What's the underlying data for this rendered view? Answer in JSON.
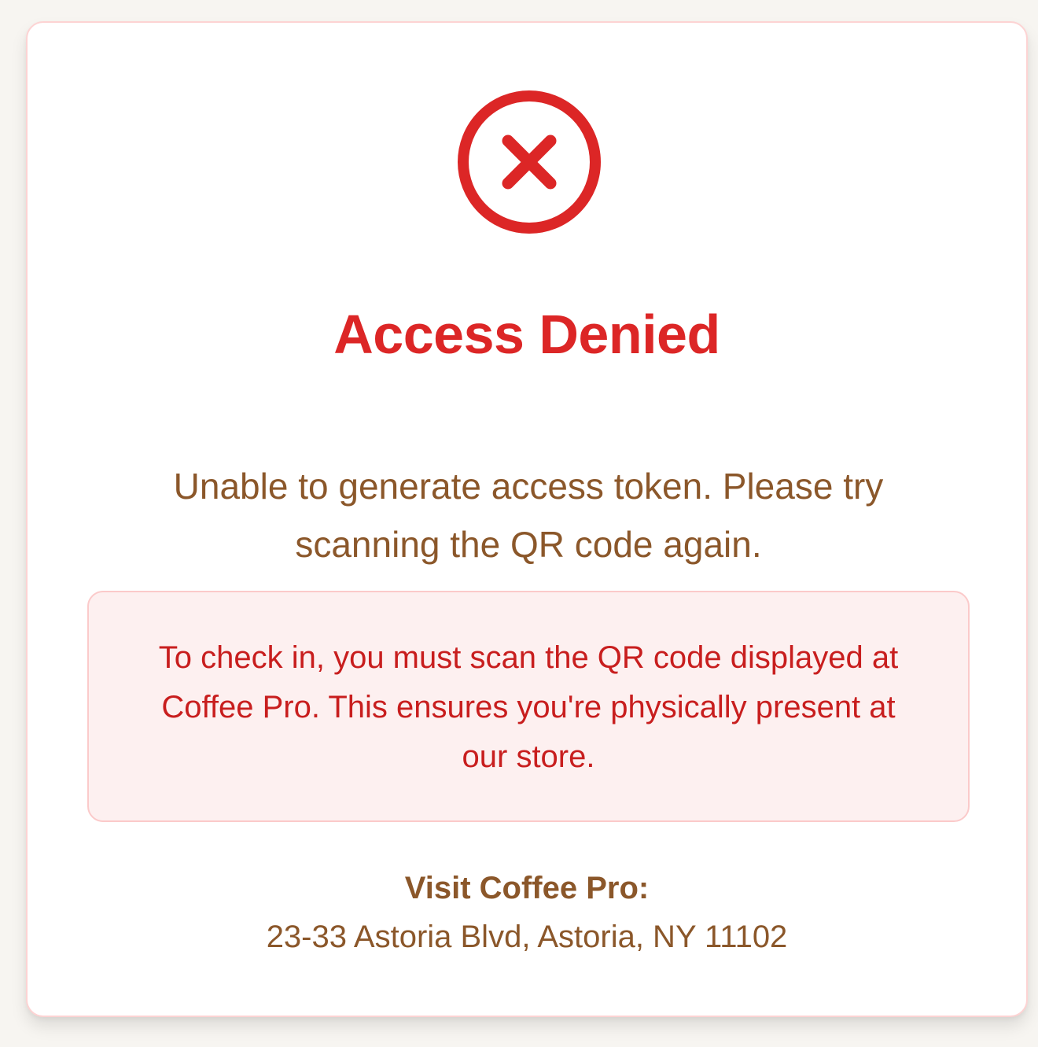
{
  "status": {
    "icon": "close-circle-icon",
    "title": "Access Denied",
    "message": "Unable to generate access token. Please try scanning the QR code again."
  },
  "notice": {
    "text": "To check in, you must scan the QR code displayed at Coffee Pro. This ensures you're physically present at our store."
  },
  "location": {
    "label": "Visit Coffee Pro:",
    "address": "23-33 Astoria Blvd, Astoria, NY 11102"
  },
  "colors": {
    "error_red": "#dc2626",
    "notice_text": "#c81e1e",
    "notice_bg": "#fdf0f0",
    "brown_text": "#8b572a",
    "card_border": "#fdd3d3",
    "page_bg": "#f7f5f1"
  }
}
